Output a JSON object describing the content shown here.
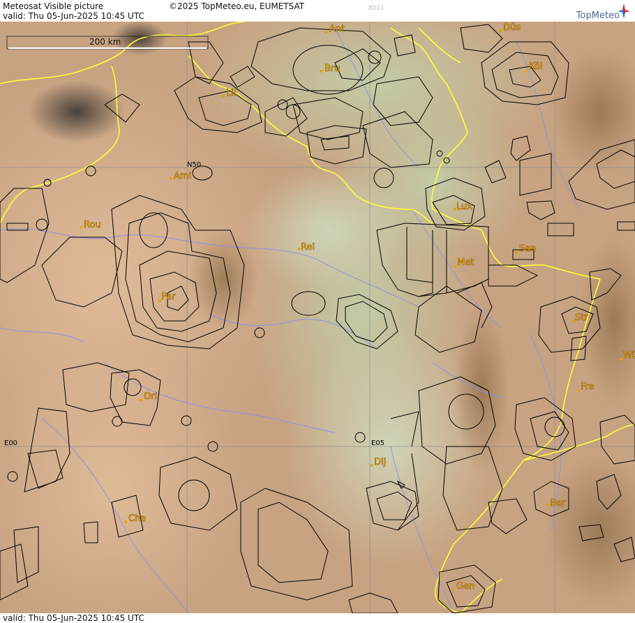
{
  "header": {
    "product_title": "Meteosat Visible picture",
    "copyright": "©2025 TopMeteo.eu, EUMETSAT",
    "tile_code": "8011",
    "valid_time": "valid:  Thu  05-Jun-2025  10:45 UTC",
    "brand": "TopMeteo"
  },
  "footer": {
    "valid_time": "valid:  Thu  05-Jun-2025  10:45 UTC"
  },
  "scale": {
    "label": "200 km"
  },
  "grid_labels": {
    "lat_n50": "N50",
    "lon_e00": "E00",
    "lon_e05": "E05"
  },
  "cities": [
    {
      "id": "ant",
      "label": "Ant"
    },
    {
      "id": "dus",
      "label": "Düs"
    },
    {
      "id": "bru",
      "label": "Bru"
    },
    {
      "id": "kol",
      "label": "Köl"
    },
    {
      "id": "lil",
      "label": "Lil"
    },
    {
      "id": "ami",
      "label": "Ami"
    },
    {
      "id": "lux",
      "label": "Lux"
    },
    {
      "id": "rou",
      "label": "Rou"
    },
    {
      "id": "rei",
      "label": "Rei"
    },
    {
      "id": "saa",
      "label": "Saa"
    },
    {
      "id": "met",
      "label": "Met"
    },
    {
      "id": "par",
      "label": "Par"
    },
    {
      "id": "str",
      "label": "Str"
    },
    {
      "id": "wue",
      "label": "Wü"
    },
    {
      "id": "fre",
      "label": "Fre"
    },
    {
      "id": "orl",
      "label": "Orl"
    },
    {
      "id": "dij",
      "label": "Dij"
    },
    {
      "id": "ber",
      "label": "Ber"
    },
    {
      "id": "cha",
      "label": "Cha"
    },
    {
      "id": "gen",
      "label": "Gen"
    }
  ],
  "colors": {
    "border": "#ffff33",
    "river": "#8a8ef0",
    "airspace": "#000000",
    "city": "#e8a000",
    "cloud": "#b9c49c",
    "land": "#c9a27e"
  }
}
